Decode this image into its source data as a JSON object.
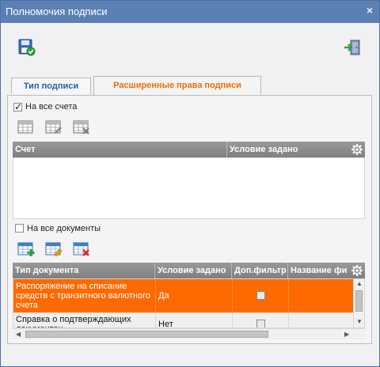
{
  "window": {
    "title": "Полномочия подписи",
    "close_glyph": "×"
  },
  "toolbar": {
    "save_icon": "save-signed-icon",
    "exit_icon": "exit-door-icon"
  },
  "tabs": [
    {
      "label": "Тип подписи",
      "active": false
    },
    {
      "label": "Расширенные права подписи",
      "active": true
    }
  ],
  "accounts": {
    "all_checkbox_label": "На все счета",
    "all_checked": true,
    "buttons": [
      "add-row-icon",
      "edit-row-icon",
      "delete-row-icon"
    ],
    "columns": [
      "Счет",
      "Условие задано"
    ],
    "rows": []
  },
  "documents": {
    "all_checkbox_label": "На все документы",
    "all_checked": false,
    "buttons": [
      "add-row-icon",
      "edit-row-icon",
      "delete-row-icon"
    ],
    "columns": [
      "Тип документа",
      "Условие задано",
      "Доп.фильтр",
      "Название фи"
    ],
    "rows": [
      {
        "doc_type": "Распоряжение на списание средств с транзитного валютного счета",
        "condition": "Да",
        "extra_filter": false,
        "filter_name": "",
        "selected": true
      },
      {
        "doc_type": "Справка о подтверждающих документах",
        "condition": "Нет",
        "extra_filter": false,
        "filter_name": "",
        "selected": false
      }
    ]
  },
  "colors": {
    "title_bar": "#5b80b3",
    "selected_row": "#ff6a00",
    "active_tab_text": "#f26d00",
    "inactive_tab_text": "#2360a7",
    "grid_header": "#8c8c8c"
  }
}
